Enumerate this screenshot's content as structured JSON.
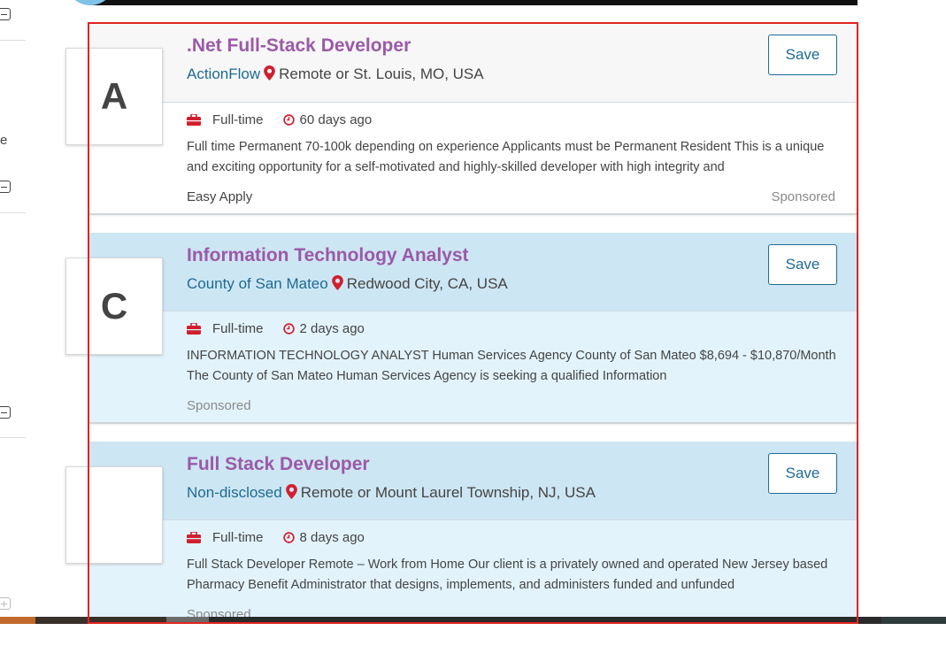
{
  "sidebar": {
    "truncated_text": "e"
  },
  "jobs": [
    {
      "logo_letter": "A",
      "title": ".Net Full-Stack Developer",
      "company": "ActionFlow",
      "location": "Remote or St. Louis, MO, USA",
      "save_label": "Save",
      "job_type": "Full-time",
      "posted": "60 days ago",
      "description": "Full time Permanent 70-100k depending on experience Applicants must be Permanent Resident This is a unique and exciting opportunity for a self-motivated and highly-skilled developer with high integrity and",
      "easy_apply": "Easy Apply",
      "sponsored": "Sponsored",
      "highlighted": false
    },
    {
      "logo_letter": "C",
      "title": "Information Technology Analyst",
      "company": "County of San Mateo",
      "location": "Redwood City, CA, USA",
      "save_label": "Save",
      "job_type": "Full-time",
      "posted": "2 days ago",
      "description": "INFORMATION TECHNOLOGY ANALYST Human Services Agency County of San Mateo $8,694 - $10,870/Month The County of San Mateo Human Services Agency is seeking a qualified Information",
      "sponsored": "Sponsored",
      "highlighted": true
    },
    {
      "logo_letter": "",
      "title": "Full Stack Developer",
      "company": "Non-disclosed",
      "location": "Remote or Mount Laurel Township, NJ, USA",
      "save_label": "Save",
      "job_type": "Full-time",
      "posted": "8 days ago",
      "description": "Full Stack Developer Remote – Work from Home Our client is a privately owned and operated New Jersey based Pharmacy Benefit Administrator that designs, implements, and administers funded and unfunded",
      "sponsored": "Sponsored",
      "highlighted": true
    }
  ],
  "colors": {
    "title": "#9b59a8",
    "company": "#1e6b94",
    "icon_red": "#d0202e",
    "highlight_head": "#cde6f3",
    "highlight_body": "#e2f3fc",
    "frame": "#e0241f"
  }
}
